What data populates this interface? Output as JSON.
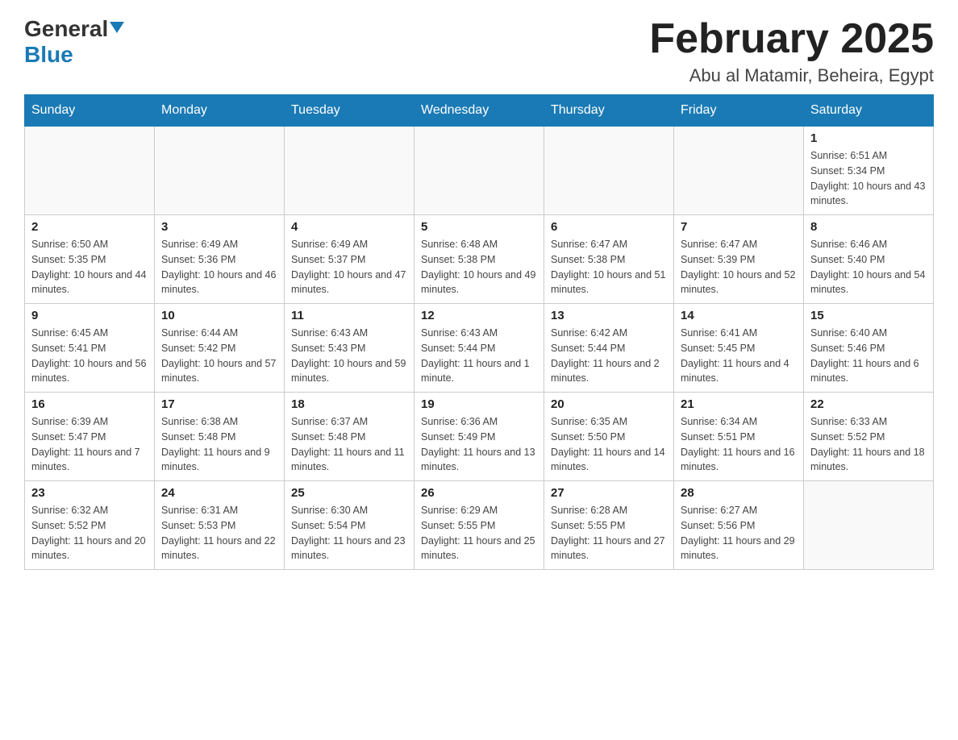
{
  "logo": {
    "general": "General",
    "blue": "Blue"
  },
  "title": "February 2025",
  "location": "Abu al Matamir, Beheira, Egypt",
  "days_of_week": [
    "Sunday",
    "Monday",
    "Tuesday",
    "Wednesday",
    "Thursday",
    "Friday",
    "Saturday"
  ],
  "weeks": [
    [
      {
        "day": "",
        "info": ""
      },
      {
        "day": "",
        "info": ""
      },
      {
        "day": "",
        "info": ""
      },
      {
        "day": "",
        "info": ""
      },
      {
        "day": "",
        "info": ""
      },
      {
        "day": "",
        "info": ""
      },
      {
        "day": "1",
        "info": "Sunrise: 6:51 AM\nSunset: 5:34 PM\nDaylight: 10 hours and 43 minutes."
      }
    ],
    [
      {
        "day": "2",
        "info": "Sunrise: 6:50 AM\nSunset: 5:35 PM\nDaylight: 10 hours and 44 minutes."
      },
      {
        "day": "3",
        "info": "Sunrise: 6:49 AM\nSunset: 5:36 PM\nDaylight: 10 hours and 46 minutes."
      },
      {
        "day": "4",
        "info": "Sunrise: 6:49 AM\nSunset: 5:37 PM\nDaylight: 10 hours and 47 minutes."
      },
      {
        "day": "5",
        "info": "Sunrise: 6:48 AM\nSunset: 5:38 PM\nDaylight: 10 hours and 49 minutes."
      },
      {
        "day": "6",
        "info": "Sunrise: 6:47 AM\nSunset: 5:38 PM\nDaylight: 10 hours and 51 minutes."
      },
      {
        "day": "7",
        "info": "Sunrise: 6:47 AM\nSunset: 5:39 PM\nDaylight: 10 hours and 52 minutes."
      },
      {
        "day": "8",
        "info": "Sunrise: 6:46 AM\nSunset: 5:40 PM\nDaylight: 10 hours and 54 minutes."
      }
    ],
    [
      {
        "day": "9",
        "info": "Sunrise: 6:45 AM\nSunset: 5:41 PM\nDaylight: 10 hours and 56 minutes."
      },
      {
        "day": "10",
        "info": "Sunrise: 6:44 AM\nSunset: 5:42 PM\nDaylight: 10 hours and 57 minutes."
      },
      {
        "day": "11",
        "info": "Sunrise: 6:43 AM\nSunset: 5:43 PM\nDaylight: 10 hours and 59 minutes."
      },
      {
        "day": "12",
        "info": "Sunrise: 6:43 AM\nSunset: 5:44 PM\nDaylight: 11 hours and 1 minute."
      },
      {
        "day": "13",
        "info": "Sunrise: 6:42 AM\nSunset: 5:44 PM\nDaylight: 11 hours and 2 minutes."
      },
      {
        "day": "14",
        "info": "Sunrise: 6:41 AM\nSunset: 5:45 PM\nDaylight: 11 hours and 4 minutes."
      },
      {
        "day": "15",
        "info": "Sunrise: 6:40 AM\nSunset: 5:46 PM\nDaylight: 11 hours and 6 minutes."
      }
    ],
    [
      {
        "day": "16",
        "info": "Sunrise: 6:39 AM\nSunset: 5:47 PM\nDaylight: 11 hours and 7 minutes."
      },
      {
        "day": "17",
        "info": "Sunrise: 6:38 AM\nSunset: 5:48 PM\nDaylight: 11 hours and 9 minutes."
      },
      {
        "day": "18",
        "info": "Sunrise: 6:37 AM\nSunset: 5:48 PM\nDaylight: 11 hours and 11 minutes."
      },
      {
        "day": "19",
        "info": "Sunrise: 6:36 AM\nSunset: 5:49 PM\nDaylight: 11 hours and 13 minutes."
      },
      {
        "day": "20",
        "info": "Sunrise: 6:35 AM\nSunset: 5:50 PM\nDaylight: 11 hours and 14 minutes."
      },
      {
        "day": "21",
        "info": "Sunrise: 6:34 AM\nSunset: 5:51 PM\nDaylight: 11 hours and 16 minutes."
      },
      {
        "day": "22",
        "info": "Sunrise: 6:33 AM\nSunset: 5:52 PM\nDaylight: 11 hours and 18 minutes."
      }
    ],
    [
      {
        "day": "23",
        "info": "Sunrise: 6:32 AM\nSunset: 5:52 PM\nDaylight: 11 hours and 20 minutes."
      },
      {
        "day": "24",
        "info": "Sunrise: 6:31 AM\nSunset: 5:53 PM\nDaylight: 11 hours and 22 minutes."
      },
      {
        "day": "25",
        "info": "Sunrise: 6:30 AM\nSunset: 5:54 PM\nDaylight: 11 hours and 23 minutes."
      },
      {
        "day": "26",
        "info": "Sunrise: 6:29 AM\nSunset: 5:55 PM\nDaylight: 11 hours and 25 minutes."
      },
      {
        "day": "27",
        "info": "Sunrise: 6:28 AM\nSunset: 5:55 PM\nDaylight: 11 hours and 27 minutes."
      },
      {
        "day": "28",
        "info": "Sunrise: 6:27 AM\nSunset: 5:56 PM\nDaylight: 11 hours and 29 minutes."
      },
      {
        "day": "",
        "info": ""
      }
    ]
  ]
}
